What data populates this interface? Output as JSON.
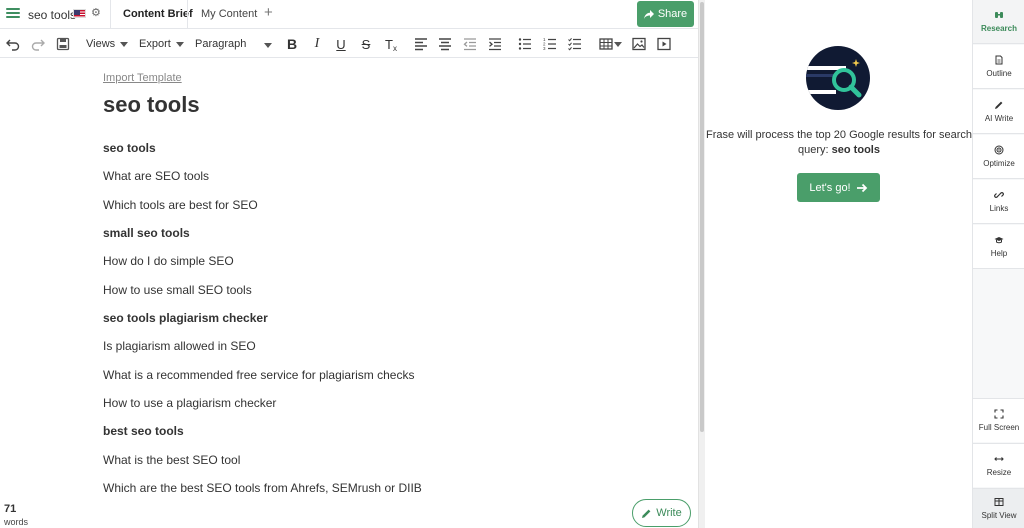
{
  "tabbar": {
    "doc_name": "seo tools",
    "tabs": [
      {
        "label": "Content Brief",
        "active": true
      },
      {
        "label": "My Content",
        "active": false
      }
    ],
    "share_label": "Share"
  },
  "toolbar": {
    "views_label": "Views",
    "export_label": "Export",
    "paragraph_label": "Paragraph"
  },
  "editor": {
    "import_template": "Import Template",
    "title": "seo tools",
    "lines": [
      {
        "text": "seo tools",
        "bold": true
      },
      {
        "text": "What are SEO tools",
        "bold": false
      },
      {
        "text": "Which tools are best for SEO",
        "bold": false
      },
      {
        "text": "small seo tools",
        "bold": true
      },
      {
        "text": "How do I do simple SEO",
        "bold": false
      },
      {
        "text": "How to use small SEO tools",
        "bold": false
      },
      {
        "text": "seo tools plagiarism checker",
        "bold": true
      },
      {
        "text": "Is plagiarism allowed in SEO",
        "bold": false
      },
      {
        "text": "What is a recommended free service for plagiarism checks",
        "bold": false
      },
      {
        "text": "How to use a plagiarism checker",
        "bold": false
      },
      {
        "text": "best seo tools",
        "bold": true
      },
      {
        "text": "What is the best SEO tool",
        "bold": false
      },
      {
        "text": "Which are the best SEO tools from Ahrefs, SEMrush or DIIB",
        "bold": false
      }
    ],
    "word_count": "71",
    "word_count_label": "words",
    "write_label": "Write"
  },
  "research": {
    "message": "Frase will process the top 20 Google results for search query:",
    "query": "seo tools",
    "button_label": "Let's go!"
  },
  "rail": {
    "items": [
      {
        "label": "Research",
        "icon": "research-icon",
        "active": true
      },
      {
        "label": "Outline",
        "icon": "outline-icon",
        "active": false
      },
      {
        "label": "AI Write",
        "icon": "ai-write-icon",
        "active": false
      },
      {
        "label": "Optimize",
        "icon": "optimize-icon",
        "active": false
      },
      {
        "label": "Links",
        "icon": "links-icon",
        "active": false
      },
      {
        "label": "Help",
        "icon": "help-icon",
        "active": false
      }
    ],
    "bottom": [
      {
        "label": "Full Screen",
        "icon": "full-screen-icon"
      },
      {
        "label": "Resize",
        "icon": "resize-icon"
      },
      {
        "label": "Split View",
        "icon": "split-view-icon"
      }
    ]
  },
  "colors": {
    "brand_green": "#4a9e6a",
    "logo_navy": "#101a33"
  }
}
